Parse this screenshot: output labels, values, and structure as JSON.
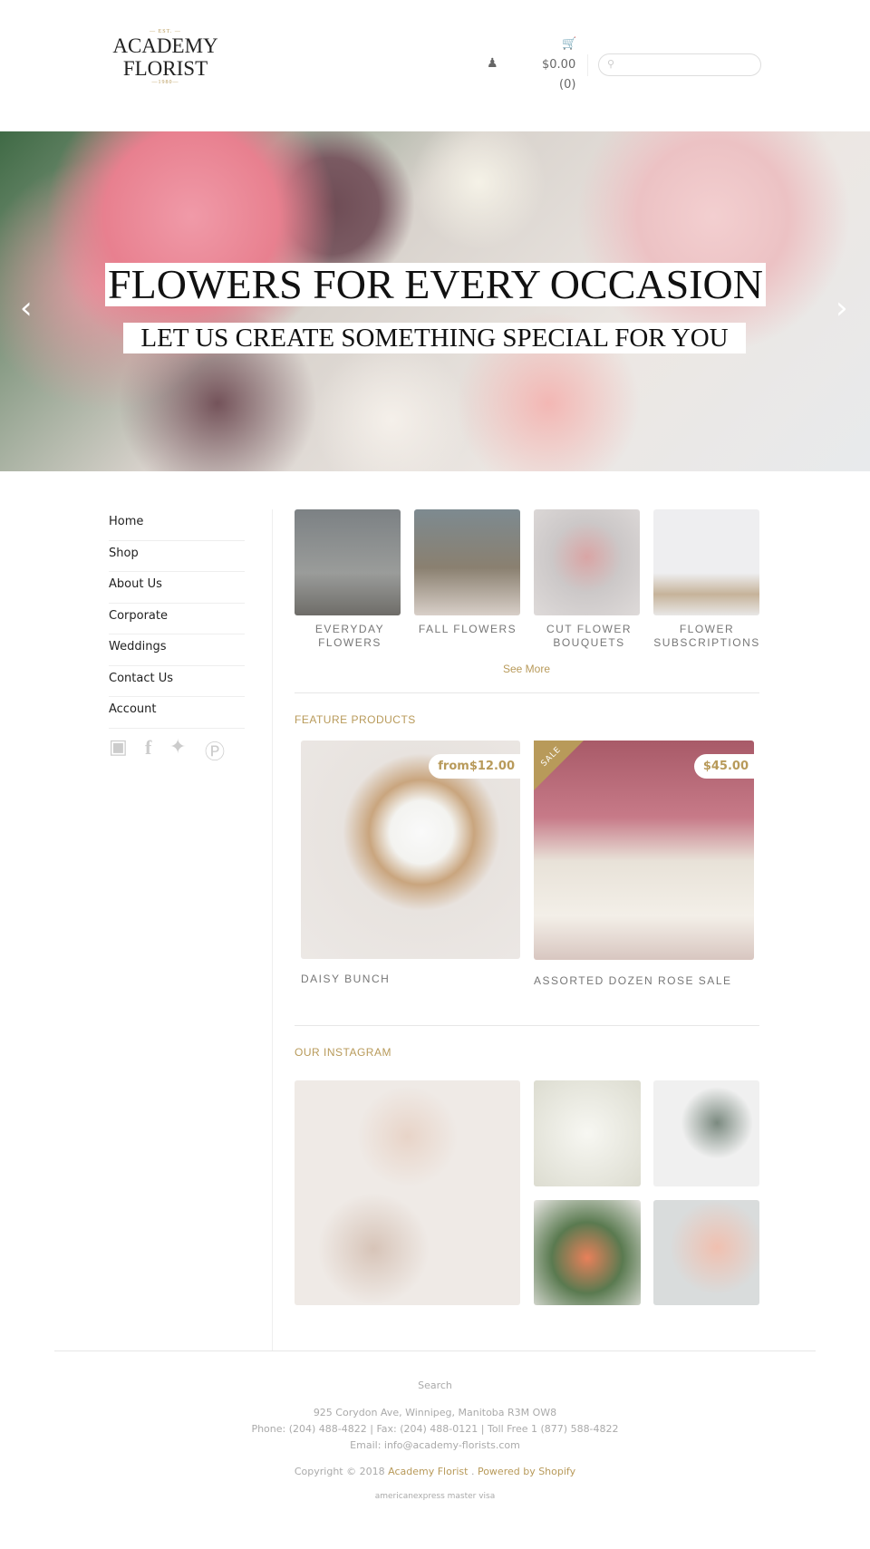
{
  "header": {
    "logo": {
      "est": "— EST. —",
      "line1": "ACADEMY",
      "line2": "FLORIST",
      "year": "—1980—"
    },
    "cart_total": "$0.00",
    "cart_count": "(0)",
    "search_placeholder": ""
  },
  "hero": {
    "title": "FLOWERS FOR EVERY OCCASION",
    "subtitle": "LET US CREATE SOMETHING SPECIAL FOR YOU"
  },
  "sidebar": {
    "items": [
      {
        "label": "Home"
      },
      {
        "label": "Shop"
      },
      {
        "label": "About Us"
      },
      {
        "label": "Corporate"
      },
      {
        "label": "Weddings"
      },
      {
        "label": "Contact Us"
      },
      {
        "label": "Account"
      }
    ],
    "social": [
      "instagram-icon",
      "facebook-icon",
      "twitter-icon",
      "pinterest-icon"
    ]
  },
  "categories": {
    "items": [
      {
        "label": "EVERYDAY FLOWERS"
      },
      {
        "label": "FALL FLOWERS"
      },
      {
        "label": "CUT FLOWER BOUQUETS"
      },
      {
        "label": "FLOWER SUBSCRIPTIONS"
      }
    ],
    "see_more": "See More"
  },
  "featured": {
    "title": "FEATURE PRODUCTS",
    "products": [
      {
        "name": "DAISY BUNCH",
        "price": "from$12.00"
      },
      {
        "name": "ASSORTED DOZEN ROSE SALE",
        "price": "$45.00",
        "badge": "SALE"
      }
    ]
  },
  "instagram": {
    "title": "OUR INSTAGRAM"
  },
  "footer": {
    "search": "Search",
    "address": "925 Corydon Ave, Winnipeg, Manitoba R3M OW8",
    "phone": "Phone: (204) 488-4822 | Fax: (204) 488-0121 | Toll Free 1 (877) 588-4822",
    "email": "Email: info@academy-florists.com",
    "copyright": "Copyright © 2018",
    "store_link": "Academy Florist",
    "sep": ".",
    "powered": "Powered by Shopify",
    "cards": "americanexpress  master  visa"
  },
  "colors": {
    "accent": "#b89a5a"
  }
}
